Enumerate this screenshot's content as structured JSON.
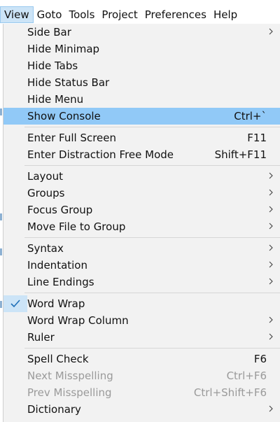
{
  "menubar": {
    "items": [
      "View",
      "Goto",
      "Tools",
      "Project",
      "Preferences",
      "Help"
    ],
    "active": "View"
  },
  "menu": {
    "groups": [
      [
        {
          "label": "Side Bar",
          "submenu": true
        },
        {
          "label": "Hide Minimap"
        },
        {
          "label": "Hide Tabs"
        },
        {
          "label": "Hide Status Bar"
        },
        {
          "label": "Hide Menu"
        },
        {
          "label": "Show Console",
          "shortcut": "Ctrl+`",
          "highlighted": true
        }
      ],
      [
        {
          "label": "Enter Full Screen",
          "shortcut": "F11"
        },
        {
          "label": "Enter Distraction Free Mode",
          "shortcut": "Shift+F11"
        }
      ],
      [
        {
          "label": "Layout",
          "submenu": true
        },
        {
          "label": "Groups",
          "submenu": true
        },
        {
          "label": "Focus Group",
          "submenu": true
        },
        {
          "label": "Move File to Group",
          "submenu": true
        }
      ],
      [
        {
          "label": "Syntax",
          "submenu": true
        },
        {
          "label": "Indentation",
          "submenu": true
        },
        {
          "label": "Line Endings",
          "submenu": true
        }
      ],
      [
        {
          "label": "Word Wrap",
          "checked": true
        },
        {
          "label": "Word Wrap Column",
          "submenu": true
        },
        {
          "label": "Ruler",
          "submenu": true
        }
      ],
      [
        {
          "label": "Spell Check",
          "shortcut": "F6"
        },
        {
          "label": "Next Misspelling",
          "shortcut": "Ctrl+F6",
          "disabled": true
        },
        {
          "label": "Prev Misspelling",
          "shortcut": "Ctrl+Shift+F6",
          "disabled": true
        },
        {
          "label": "Dictionary",
          "submenu": true
        }
      ]
    ]
  },
  "icons": {
    "check": "check-icon",
    "submenu": "chevron-right-icon"
  },
  "colors": {
    "highlight": "#91c9f7",
    "menubar_active": "#cce4f7",
    "menu_bg": "#f2f2f2",
    "disabled_text": "#9a9a9a"
  }
}
